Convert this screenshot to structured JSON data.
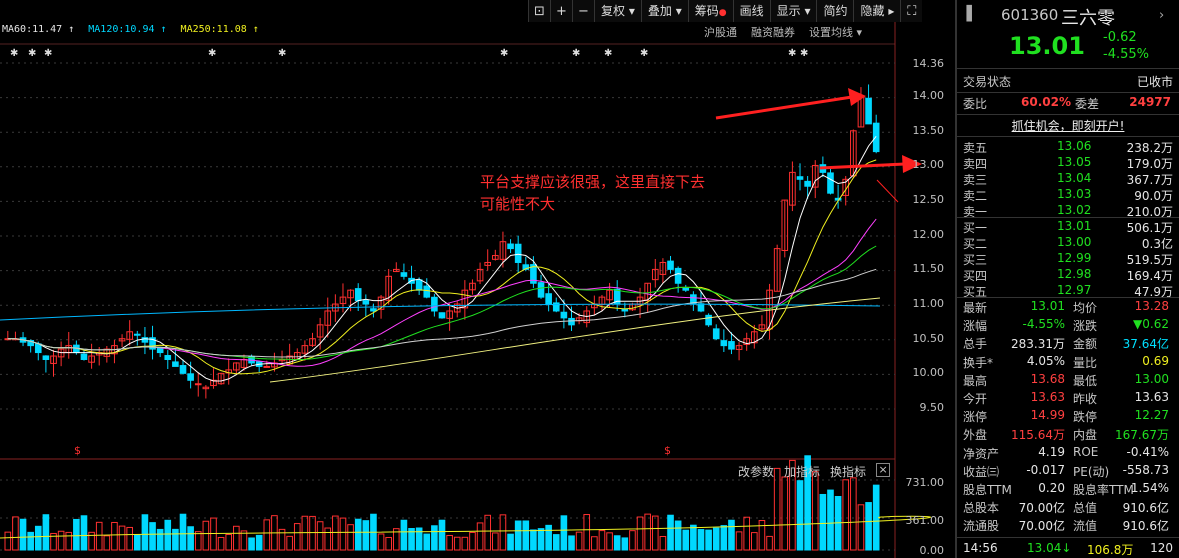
{
  "toolbar": {
    "icons": [
      "lock-icon",
      "plus-icon",
      "minus-icon"
    ],
    "buttons": [
      {
        "label": "复权",
        "dropdown": true
      },
      {
        "label": "叠加",
        "dropdown": true
      },
      {
        "label": "筹码",
        "dot": true
      },
      {
        "label": "画线"
      },
      {
        "label": "显示",
        "dropdown": true
      },
      {
        "label": "简约"
      },
      {
        "label": "隐藏",
        "arrow": true
      }
    ]
  },
  "ma": [
    {
      "label": "MA60:11.47",
      "color": "#e6e6e6"
    },
    {
      "label": "MA120:10.94",
      "color": "#00d8ff"
    },
    {
      "label": "MA250:11.08",
      "color": "#f0f020"
    }
  ],
  "links": {
    "hgt": "沪股通",
    "rzrq": "融资融券",
    "setting": "设置均线"
  },
  "price_axis": [
    "14.36",
    "14.00",
    "13.50",
    "13.00",
    "12.50",
    "12.00",
    "11.50",
    "11.00",
    "10.50",
    "10.00",
    "9.50"
  ],
  "volume_axis": [
    "731.00",
    "361.00",
    "0.00"
  ],
  "annotation": {
    "line1": "平台支撑应该很强，这里直接下去",
    "line2": "可能性不大"
  },
  "sub_toolbar": {
    "change_param": "改参数",
    "add_indicator": "加指标",
    "switch_indicator": "换指标"
  },
  "markers": {
    "dollar": "$"
  },
  "quote": {
    "code": "601360",
    "name": "三六零",
    "price": "13.01",
    "change": "-0.62",
    "change_pct": "-4.55%",
    "status_label": "交易状态",
    "status_value": "已收市",
    "ratio_label": "委比",
    "ratio_value": "60.02%",
    "diff_label": "委差",
    "diff_value": "24977",
    "promo": "抓住机会，即刻开户!"
  },
  "order_book": {
    "asks": [
      {
        "label": "卖五",
        "price": "13.06",
        "vol": "238.2万"
      },
      {
        "label": "卖四",
        "price": "13.05",
        "vol": "179.0万"
      },
      {
        "label": "卖三",
        "price": "13.04",
        "vol": "367.7万"
      },
      {
        "label": "卖二",
        "price": "13.03",
        "vol": "90.0万"
      },
      {
        "label": "卖一",
        "price": "13.02",
        "vol": "210.0万"
      }
    ],
    "bids": [
      {
        "label": "买一",
        "price": "13.01",
        "vol": "506.1万"
      },
      {
        "label": "买二",
        "price": "13.00",
        "vol": "0.3亿"
      },
      {
        "label": "买三",
        "price": "12.99",
        "vol": "519.5万"
      },
      {
        "label": "买四",
        "price": "12.98",
        "vol": "169.4万"
      },
      {
        "label": "买五",
        "price": "12.97",
        "vol": "47.9万"
      }
    ]
  },
  "stats": [
    [
      {
        "l": "最新",
        "v": "13.01",
        "c": "green"
      },
      {
        "l": "均价",
        "v": "13.28",
        "c": "red"
      }
    ],
    [
      {
        "l": "涨幅",
        "v": "-4.55%",
        "c": "green"
      },
      {
        "l": "涨跌",
        "v": "▼0.62",
        "c": "green"
      }
    ],
    [
      {
        "l": "总手",
        "v": "283.31万",
        "c": "white"
      },
      {
        "l": "金额",
        "v": "37.64亿",
        "c": "cyan"
      }
    ],
    [
      {
        "l": "换手*",
        "v": "4.05%",
        "c": "white"
      },
      {
        "l": "量比",
        "v": "0.69",
        "c": "yellow"
      }
    ],
    [
      {
        "l": "最高",
        "v": "13.68",
        "c": "red"
      },
      {
        "l": "最低",
        "v": "13.00",
        "c": "green"
      }
    ],
    [
      {
        "l": "今开",
        "v": "13.63",
        "c": "red"
      },
      {
        "l": "昨收",
        "v": "13.63",
        "c": "white"
      }
    ],
    [
      {
        "l": "涨停",
        "v": "14.99",
        "c": "red"
      },
      {
        "l": "跌停",
        "v": "12.27",
        "c": "green"
      }
    ],
    [
      {
        "l": "外盘",
        "v": "115.64万",
        "c": "red"
      },
      {
        "l": "内盘",
        "v": "167.67万",
        "c": "green"
      }
    ],
    [
      {
        "l": "净资产",
        "v": "4.19",
        "c": "white"
      },
      {
        "l": "ROE",
        "v": "-0.41%",
        "c": "white"
      }
    ],
    [
      {
        "l": "收益㈢",
        "v": "-0.017",
        "c": "white"
      },
      {
        "l": "PE(动)",
        "v": "-558.73",
        "c": "white"
      }
    ],
    [
      {
        "l": "股息TTM",
        "v": "0.20",
        "c": "white"
      },
      {
        "l": "股息率TTM",
        "v": "1.54%",
        "c": "white"
      }
    ],
    [
      {
        "l": "总股本",
        "v": "70.00亿",
        "c": "white"
      },
      {
        "l": "总值",
        "v": "910.6亿",
        "c": "white"
      }
    ],
    [
      {
        "l": "流通股",
        "v": "70.00亿",
        "c": "white"
      },
      {
        "l": "流值",
        "v": "910.6亿",
        "c": "white"
      }
    ]
  ],
  "tick": {
    "time": "14:56",
    "price": "13.04",
    "vol": "106.8万",
    "n": "120"
  },
  "colors": {
    "up": "#ff3030",
    "down": "#00d8ff",
    "bg": "#000000",
    "grid": "#444444"
  }
}
